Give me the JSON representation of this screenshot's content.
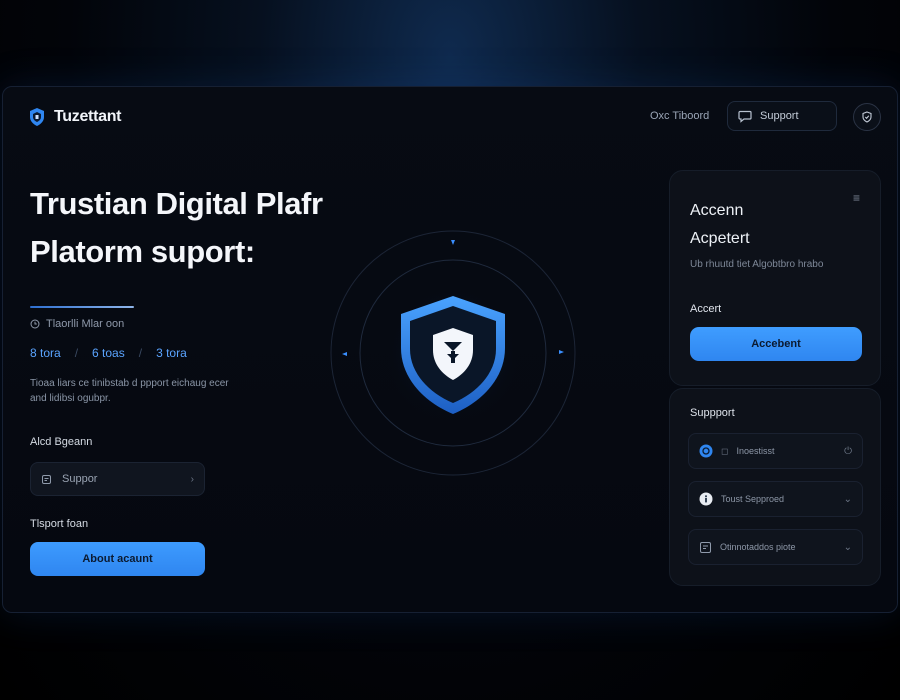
{
  "header": {
    "brand": "Tuzettant",
    "link": "Oxc Tiboord",
    "support_button": "Support"
  },
  "hero": {
    "title_line1": "Trustian Digital Plafr",
    "title_line2": "Platorm suport:",
    "meta": "Tlaorlli Mlar oon",
    "stats": [
      "8 tora",
      "6 toas",
      "3 tora"
    ],
    "description": "Tioaa liars ce tinibstab d ppport eichaug ecer and lidibsi ogubpr."
  },
  "form": {
    "select_label": "Alcd Bgeann",
    "select_value": "Suppor",
    "section_label": "Tlsport foan",
    "primary_button": "About acaunt"
  },
  "account_panel": {
    "title_line1": "Accenn",
    "title_line2": "Acpetert",
    "subtitle": "Ub rhuutd tiet Algobtbro hrabo",
    "label": "Accert",
    "button": "Accebent"
  },
  "support_panel": {
    "title": "Suppport",
    "rows": [
      {
        "label": "Inoestisst"
      },
      {
        "label": "Toust Sepproed"
      },
      {
        "label": "Otinnotaddos piote"
      }
    ]
  },
  "colors": {
    "accent": "#3a96fb",
    "background": "#05080f",
    "panel": "#0d1119"
  }
}
